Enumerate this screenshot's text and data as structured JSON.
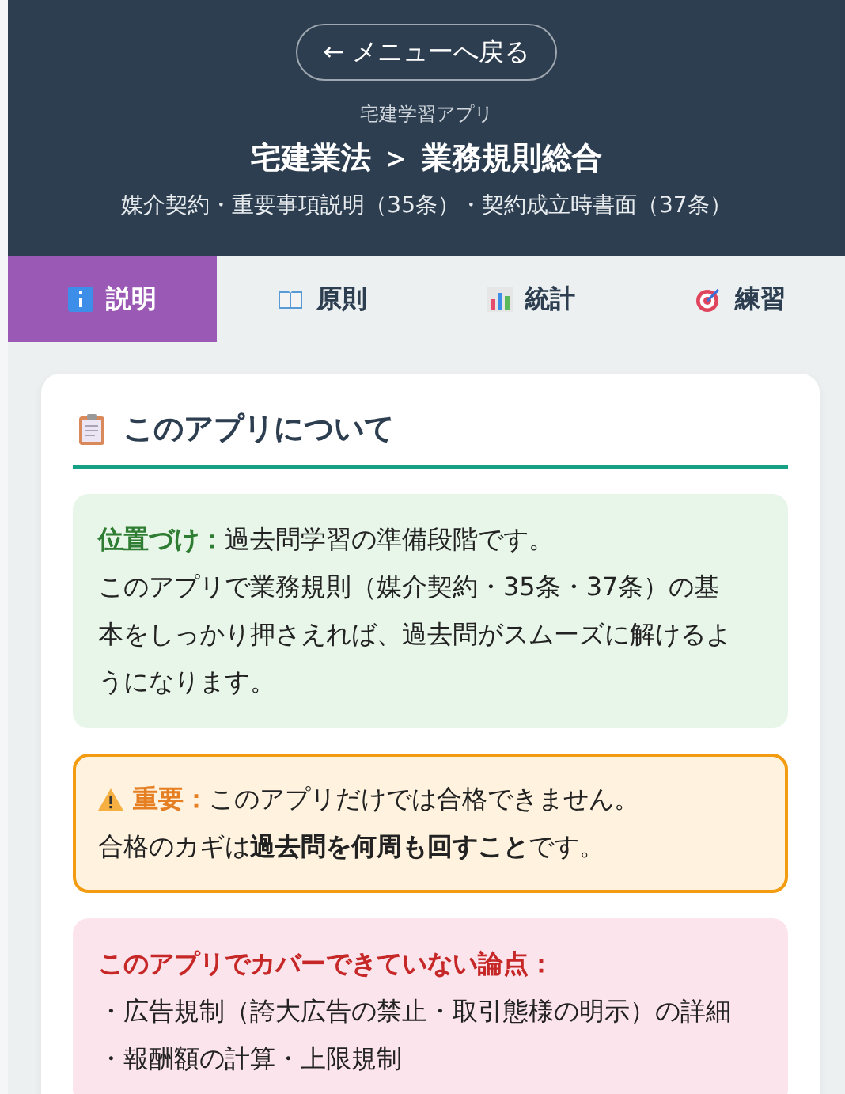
{
  "header": {
    "back_button": "← メニューへ戻る",
    "app_name": "宅建学習アプリ",
    "title": "宅建業法 ＞ 業務規則総合",
    "subtitle": "媒介契約・重要事項説明（35条）・契約成立時書面（37条）"
  },
  "tabs": [
    {
      "label": "説明",
      "kind": "info",
      "selected": true
    },
    {
      "label": "原則",
      "kind": "book",
      "selected": false
    },
    {
      "label": "統計",
      "kind": "chart",
      "selected": false
    },
    {
      "label": "練習",
      "kind": "target",
      "selected": false
    }
  ],
  "card": {
    "heading": "このアプリについて",
    "notes": [
      {
        "kind": "info",
        "lines": [
          {
            "label": "位置づけ：",
            "text": "過去問学習の準備段階です。"
          },
          {
            "text": "このアプリで業務規則（媒介契約・35条・37条）の基本をしっかり押さえれば、過去問がスムーズに解けるようになります。"
          }
        ]
      },
      {
        "kind": "warning",
        "lines": [
          {
            "label": "重要：",
            "text": "このアプリだけでは合格できません。"
          },
          {
            "text": "合格のカギは**過去問を何周も回すこと**です。"
          }
        ]
      },
      {
        "kind": "danger",
        "lines": [
          {
            "label": "このアプリでカバーできていない論点："
          },
          {
            "text": "・広告規制（誇大広告の禁止・取引態様の明示）の詳細"
          },
          {
            "text": "・報酬額の計算・上限規制"
          }
        ]
      }
    ]
  }
}
